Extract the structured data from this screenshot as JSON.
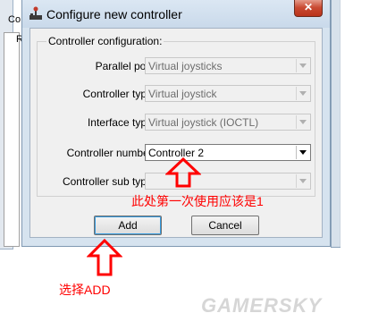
{
  "background": {
    "label_top": "Co",
    "label_panel": "R"
  },
  "dialog": {
    "title": "Configure new controller",
    "close_glyph": "✕",
    "group_title": "Controller configuration:",
    "fields": [
      {
        "label": "Parallel port:",
        "value": "Virtual joysticks",
        "enabled": false
      },
      {
        "label": "Controller type:",
        "value": "Virtual joystick",
        "enabled": false
      },
      {
        "label": "Interface type:",
        "value": "Virtual joystick (IOCTL)",
        "enabled": false
      },
      {
        "label": "Controller number:",
        "value": "Controller 2",
        "enabled": true
      },
      {
        "label": "Controller sub type:",
        "value": "",
        "enabled": false
      }
    ],
    "add_label": "Add",
    "cancel_label": "Cancel"
  },
  "annotations": {
    "note_controller": "此处第一次使用应该是1",
    "note_add": "选择ADD",
    "color": "#ff0000"
  },
  "watermark": "GAMERSKY",
  "icons": [
    "app-icon",
    "close-icon",
    "dropdown-arrow-icon",
    "up-arrow-icon"
  ]
}
